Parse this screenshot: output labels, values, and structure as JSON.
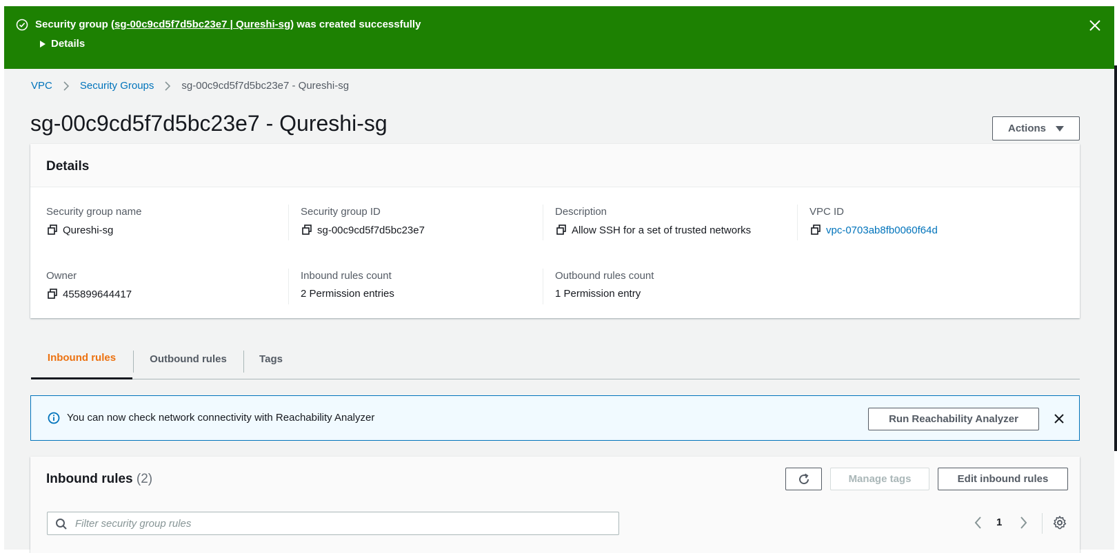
{
  "flash": {
    "prefix": "Security group (",
    "link": "sg-00c9cd5f7d5bc23e7 | Qureshi-sg",
    "suffix": ") was created successfully",
    "details_label": "Details",
    "color": "#1d8102"
  },
  "breadcrumb": {
    "items": [
      "VPC",
      "Security Groups"
    ],
    "current": "sg-00c9cd5f7d5bc23e7 - Qureshi-sg"
  },
  "page": {
    "title": "sg-00c9cd5f7d5bc23e7 - Qureshi-sg",
    "actions_label": "Actions"
  },
  "details": {
    "heading": "Details",
    "fields": [
      {
        "label": "Security group name",
        "value": "Qureshi-sg"
      },
      {
        "label": "Security group ID",
        "value": "sg-00c9cd5f7d5bc23e7"
      },
      {
        "label": "Description",
        "value": "Allow SSH for a set of trusted networks"
      },
      {
        "label": "VPC ID",
        "value": "vpc-0703ab8fb0060f64d"
      },
      {
        "label": "Owner",
        "value": "455899644417"
      },
      {
        "label": "Inbound rules count",
        "value": "2 Permission entries"
      },
      {
        "label": "Outbound rules count",
        "value": "1 Permission entry"
      }
    ]
  },
  "tabs": {
    "items": [
      "Inbound rules",
      "Outbound rules",
      "Tags"
    ],
    "active": "Inbound rules",
    "active_color": "#ec7211"
  },
  "alert": {
    "text": "You can now check network connectivity with Reachability Analyzer",
    "button": "Run Reachability Analyzer"
  },
  "inbound": {
    "title": "Inbound rules",
    "count": "(2)",
    "manage_tags": "Manage tags",
    "edit": "Edit inbound rules",
    "search_placeholder": "Filter security group rules",
    "page": "1"
  },
  "colors": {
    "link": "#0073bb",
    "text": "#16191f",
    "muted": "#545b64",
    "background": "#f2f3f3"
  }
}
